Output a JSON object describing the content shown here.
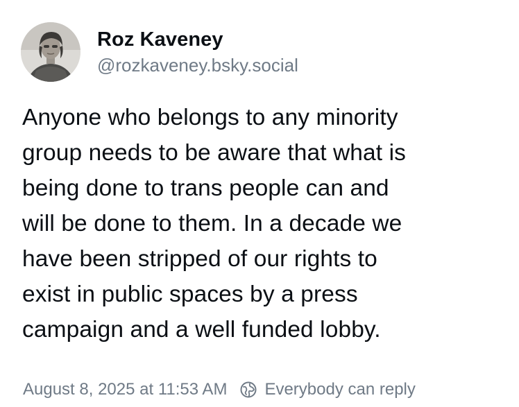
{
  "author": {
    "display_name": "Roz Kaveney",
    "handle": "@rozkaveney.bsky.social",
    "avatar_icon": "profile-photo"
  },
  "post": {
    "text": "Anyone who belongs to any minority\ngroup needs to be aware that what is\nbeing done to trans people can and\nwill be done to them. In a decade we\nhave been stripped of our rights to\nexist in public spaces by a press\ncampaign and a well funded lobby."
  },
  "meta": {
    "timestamp": "August 8, 2025 at 11:53 AM",
    "reply_setting": "Everybody can reply",
    "reply_icon": "globe-icon"
  },
  "colors": {
    "text": "#0b0f14",
    "muted": "#6f7a86",
    "background": "#ffffff"
  }
}
